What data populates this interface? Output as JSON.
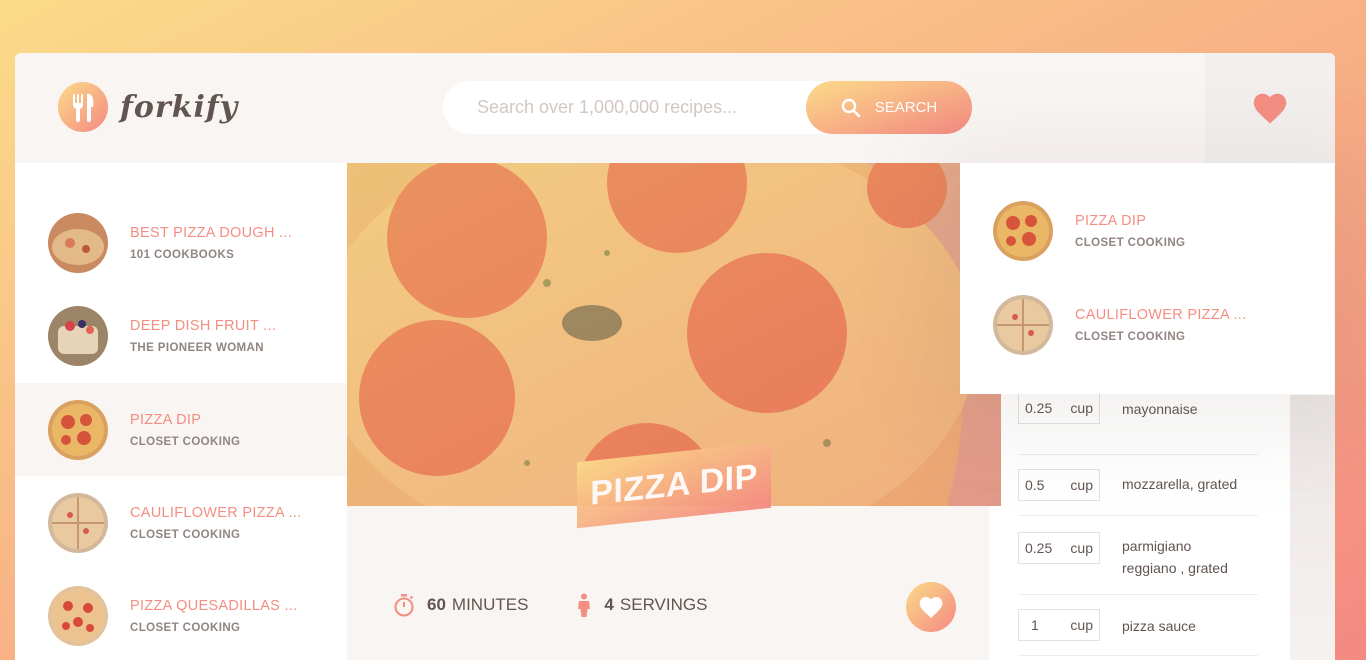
{
  "brand": {
    "name": "forkify"
  },
  "search": {
    "placeholder": "Search over 1,000,000 recipes...",
    "button_label": "SEARCH"
  },
  "results": [
    {
      "title": "BEST PIZZA DOUGH ...",
      "publisher": "101 COOKBOOKS",
      "active": false
    },
    {
      "title": "DEEP DISH FRUIT ...",
      "publisher": "THE PIONEER WOMAN",
      "active": false
    },
    {
      "title": "PIZZA DIP",
      "publisher": "CLOSET COOKING",
      "active": true
    },
    {
      "title": "CAULIFLOWER PIZZA ...",
      "publisher": "CLOSET COOKING",
      "active": false
    },
    {
      "title": "PIZZA QUESADILLAS ...",
      "publisher": "CLOSET COOKING",
      "active": false
    }
  ],
  "recipe": {
    "title": "PIZZA DIP",
    "time_value": "60",
    "time_unit": "MINUTES",
    "servings_value": "4",
    "servings_unit": "SERVINGS"
  },
  "ingredients": [
    {
      "count": "0.25",
      "unit": "cup",
      "name": "mayonnaise"
    },
    {
      "count": "0.5",
      "unit": "cup",
      "name": "mozzarella, grated"
    },
    {
      "count": "0.25",
      "unit": "cup",
      "name": "parmigiano reggiano , grated"
    },
    {
      "count": "1",
      "unit": "cup",
      "name": "pizza sauce"
    }
  ],
  "likes": [
    {
      "title": "PIZZA DIP",
      "publisher": "CLOSET COOKING"
    },
    {
      "title": "CAULIFLOWER PIZZA ...",
      "publisher": "CLOSET COOKING"
    }
  ],
  "colors": {
    "accent": "#f38e82",
    "grad_start": "#fbdb89",
    "grad_end": "#f48982"
  },
  "icons": {
    "logo": "fork-knife-icon",
    "search": "search-icon",
    "likes": "heart-icon",
    "time": "stopwatch-icon",
    "servings": "person-icon"
  }
}
